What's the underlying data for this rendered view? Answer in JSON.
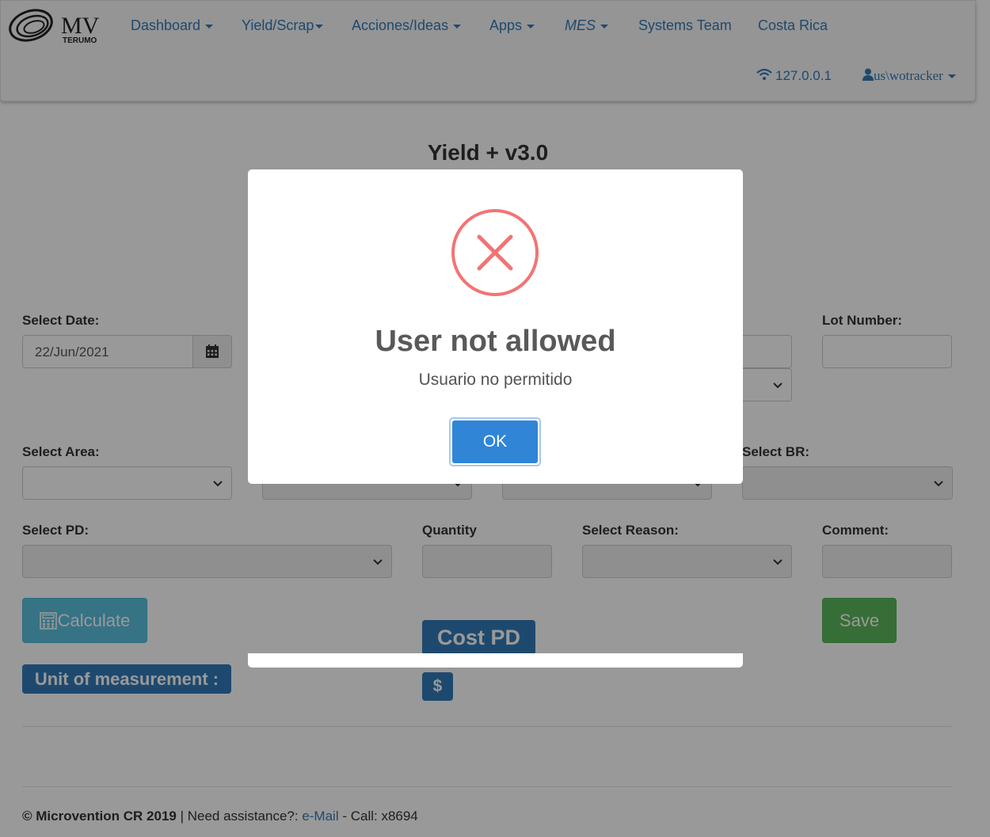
{
  "navbar": {
    "logo_text": "MV",
    "logo_sub": "TERUMO",
    "items": [
      {
        "label": "Dashboard",
        "caret": true
      },
      {
        "label": "Yield/Scrap",
        "caret": true
      },
      {
        "label": "Acciones/Ideas",
        "caret": true
      },
      {
        "label": "Apps",
        "caret": true
      },
      {
        "label": "MES",
        "caret": true
      },
      {
        "label": "Systems Team",
        "caret": false
      },
      {
        "label": "Costa Rica",
        "caret": false
      }
    ],
    "ip": "127.0.0.1",
    "user": "us\\wotracker"
  },
  "page": {
    "title": "Yield + v3.0"
  },
  "form": {
    "date_label": "Select Date:",
    "date_value": "22/Jun/2021",
    "lot_label": "Lot Number:",
    "area_label": "Select Area:",
    "br_label": "Select BR:",
    "pd_label": "Select PD:",
    "quantity_label": "Quantity",
    "reason_label": "Select Reason:",
    "comment_label": "Comment:",
    "calculate_label": "Calculate",
    "save_label": "Save",
    "cost_pd_label": "Cost PD",
    "unit_label": "Unit of measurement :",
    "dollar_label": "$"
  },
  "footer": {
    "copyright": "© Microvention CR 2019",
    "assist": " | Need assistance?: ",
    "email_link": "e-Mail",
    "call": " - Call: x8694"
  },
  "modal": {
    "title": "User not allowed",
    "text": "Usuario no permitido",
    "ok_label": "OK"
  },
  "colors": {
    "link": "#337ab7",
    "error": "#f27474",
    "ok_button": "#3085d6",
    "calc_button": "#5bc0de",
    "save_button": "#5cb85c"
  }
}
